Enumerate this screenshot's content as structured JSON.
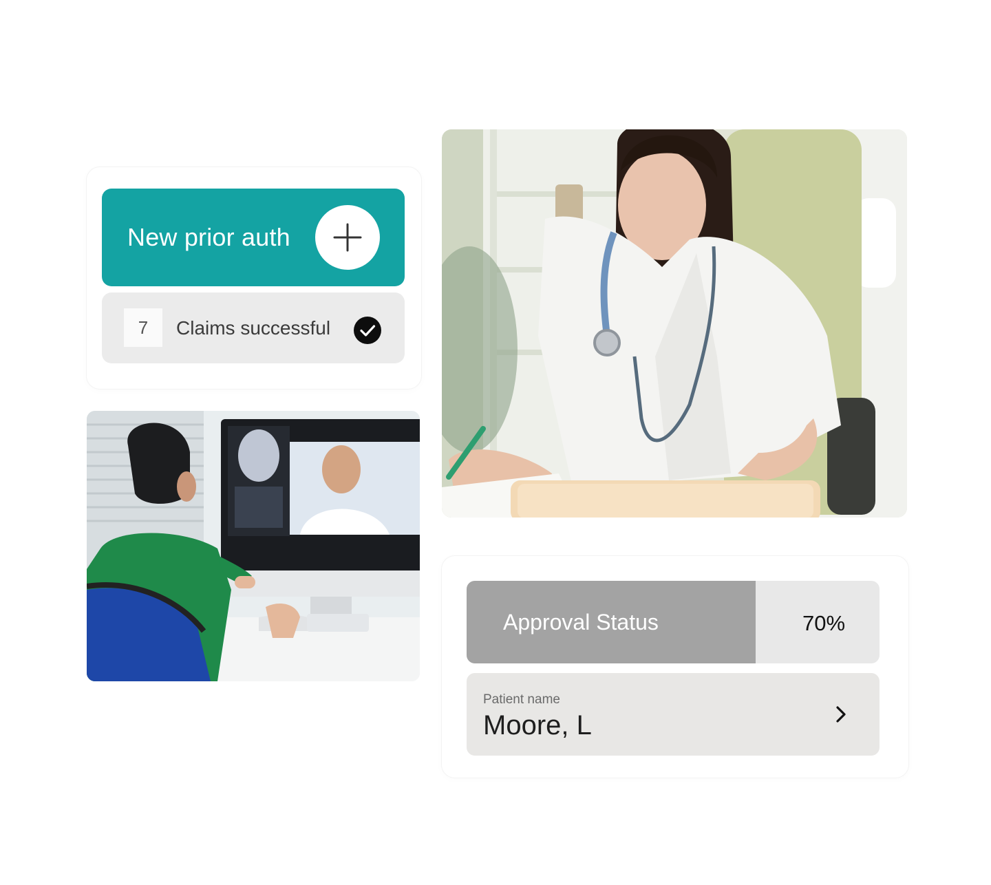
{
  "prior_auth": {
    "new_button_label": "New prior auth",
    "add_icon": "plus-icon",
    "claims_count": "7",
    "claims_label": "Claims successful",
    "claims_icon": "check-circle-icon"
  },
  "approval": {
    "label": "Approval Status",
    "percent_text": "70%",
    "progress": 0.7
  },
  "patient": {
    "label": "Patient name",
    "name": "Moore, L",
    "action_icon": "chevron-right-icon"
  },
  "colors": {
    "accent": "#14a3a3",
    "progress_fill": "#a3a3a3",
    "progress_track": "#e8e8e8",
    "card_gray": "#ebebeb"
  },
  "images": [
    {
      "name": "doctor-photo",
      "subject": "doctor at desk with stethoscope"
    },
    {
      "name": "telehealth-photo",
      "subject": "nurse on video call with doctor"
    }
  ]
}
